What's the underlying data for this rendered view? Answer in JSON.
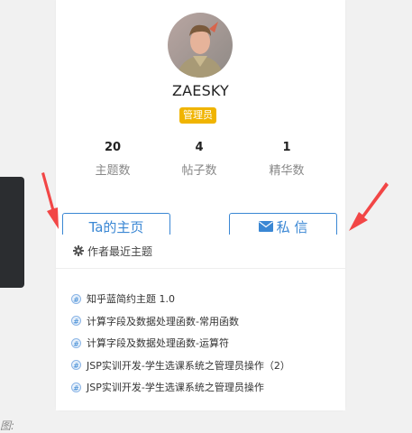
{
  "profile": {
    "username": "ZAESKY",
    "role": "管理员",
    "stats": [
      {
        "value": "20",
        "label": "主题数"
      },
      {
        "value": "4",
        "label": "帖子数"
      },
      {
        "value": "1",
        "label": "精华数"
      }
    ]
  },
  "buttons": {
    "home": "Ta的主页",
    "message": "私 信"
  },
  "popup": {
    "title": "作者最近主题",
    "topics": [
      "知乎蓝简约主题 1.0",
      "计算字段及数据处理函数-常用函数",
      "计算字段及数据处理函数-运算符",
      "JSP实训开发-学生选课系统之管理员操作（2）",
      "JSP实训开发-学生选课系统之管理员操作"
    ]
  },
  "caption_fragment": "图:",
  "colors": {
    "accent": "#3a87d4",
    "badge": "#f0b400",
    "arrow": "#f24646",
    "sidebar_dark": "#2b2d30"
  }
}
